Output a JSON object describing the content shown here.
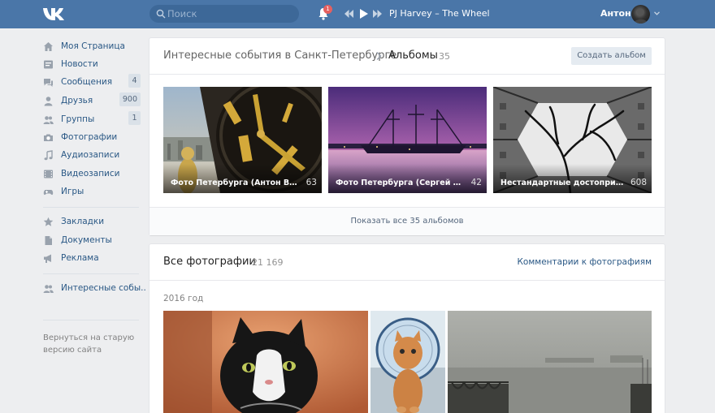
{
  "header": {
    "search_placeholder": "Поиск",
    "notification_count": "1",
    "track": "PJ Harvey – The Wheel",
    "username": "Антон"
  },
  "sidebar": {
    "items": [
      {
        "label": "Моя Страница",
        "icon": "home-icon"
      },
      {
        "label": "Новости",
        "icon": "news-icon"
      },
      {
        "label": "Сообщения",
        "icon": "messages-icon",
        "count": "4"
      },
      {
        "label": "Друзья",
        "icon": "friends-icon",
        "count": "900"
      },
      {
        "label": "Группы",
        "icon": "groups-icon",
        "count": "1"
      },
      {
        "label": "Фотографии",
        "icon": "camera-icon"
      },
      {
        "label": "Аудиозаписи",
        "icon": "music-icon"
      },
      {
        "label": "Видеозаписи",
        "icon": "video-icon"
      },
      {
        "label": "Игры",
        "icon": "gamepad-icon"
      }
    ],
    "extra": [
      {
        "label": "Закладки",
        "icon": "star-icon"
      },
      {
        "label": "Документы",
        "icon": "document-icon"
      },
      {
        "label": "Реклама",
        "icon": "megaphone-icon"
      }
    ],
    "community": {
      "label": "Интересные собы..",
      "icon": "community-icon"
    },
    "old_version": "Вернуться на старую версию сайта"
  },
  "albums_section": {
    "group_name": "Интересные события в Санкт-Петербурге",
    "title": "Альбомы",
    "count": "35",
    "create_button": "Создать альбом",
    "albums": [
      {
        "title": "Фото Петербурга (Антон Ваган...",
        "count": "63"
      },
      {
        "title": "Фото Петербурга (Сергей Лукс)",
        "count": "42"
      },
      {
        "title": "Нестандартные достопримеч...",
        "count": "608"
      }
    ],
    "show_all": "Показать все 35 альбомов"
  },
  "photos_section": {
    "title": "Все фотографии",
    "count": "21 169",
    "comments_link": "Комментарии к фотографиям",
    "year": "2016 год"
  },
  "colors": {
    "header_bg": "#4a76a8",
    "page_bg": "#edeef0",
    "link": "#2a5885",
    "icon": "#99a2ad"
  }
}
